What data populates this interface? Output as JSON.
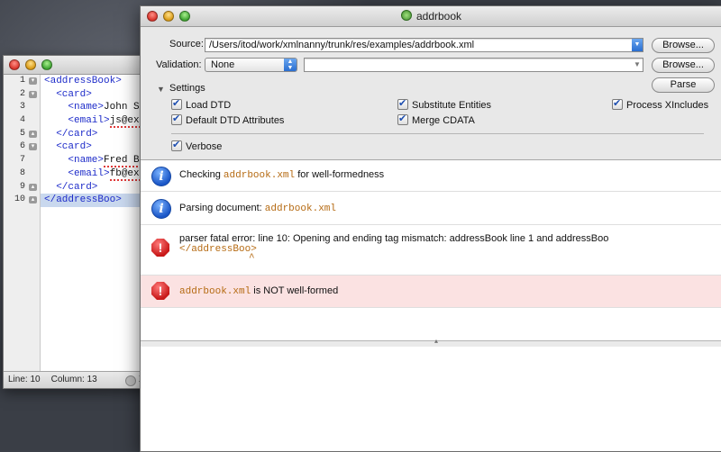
{
  "editor": {
    "lines": [
      {
        "num": "1",
        "code": "<addressBook>"
      },
      {
        "num": "2",
        "code": "  <card>"
      },
      {
        "num": "3",
        "indent": "    ",
        "tag": "<name>",
        "text": "John Smi"
      },
      {
        "num": "4",
        "indent": "    ",
        "tag": "<email>",
        "text": "js@exam"
      },
      {
        "num": "5",
        "code": "  </card>"
      },
      {
        "num": "6",
        "code": "  <card>"
      },
      {
        "num": "7",
        "indent": "    ",
        "tag": "<name>",
        "text": "Fred Bl"
      },
      {
        "num": "8",
        "indent": "    ",
        "tag": "<email>",
        "text": "fb@exam"
      },
      {
        "num": "9",
        "code": "  </card>"
      },
      {
        "num": "10",
        "code": "</addressBoo>"
      }
    ],
    "status": {
      "line": "Line: 10",
      "column": "Column: 13",
      "extra": "X"
    }
  },
  "window": {
    "title": "addrbook"
  },
  "source": {
    "label": "Source:",
    "value": "/Users/itod/work/xmlnanny/trunk/res/examples/addrbook.xml",
    "browse": "Browse..."
  },
  "validation": {
    "label": "Validation:",
    "selected": "None",
    "value": "",
    "browse": "Browse..."
  },
  "settings": {
    "label": "Settings",
    "parse": "Parse",
    "options": {
      "load_dtd": "Load DTD",
      "default_dtd_attributes": "Default DTD Attributes",
      "substitute_entities": "Substitute Entities",
      "merge_cdata": "Merge CDATA",
      "process_xincludes": "Process XIncludes",
      "verbose": "Verbose"
    }
  },
  "messages": {
    "m1": {
      "pre": "Checking ",
      "file": "addrbook.xml",
      "post": " for well-formedness"
    },
    "m2": {
      "pre": "Parsing document: ",
      "file": "addrbook.xml"
    },
    "m3": {
      "text": "parser fatal error: line 10: Opening and ending tag mismatch: addressBook line 1 and addressBoo",
      "code": "</addressBoo>",
      "caret": "^"
    },
    "m4": {
      "file": "addrbook.xml",
      "post": " is NOT well-formed"
    }
  },
  "colors": {
    "tag": "#1d2bc9",
    "file": "#b56a12",
    "error_bg": "#fbe2e2"
  }
}
